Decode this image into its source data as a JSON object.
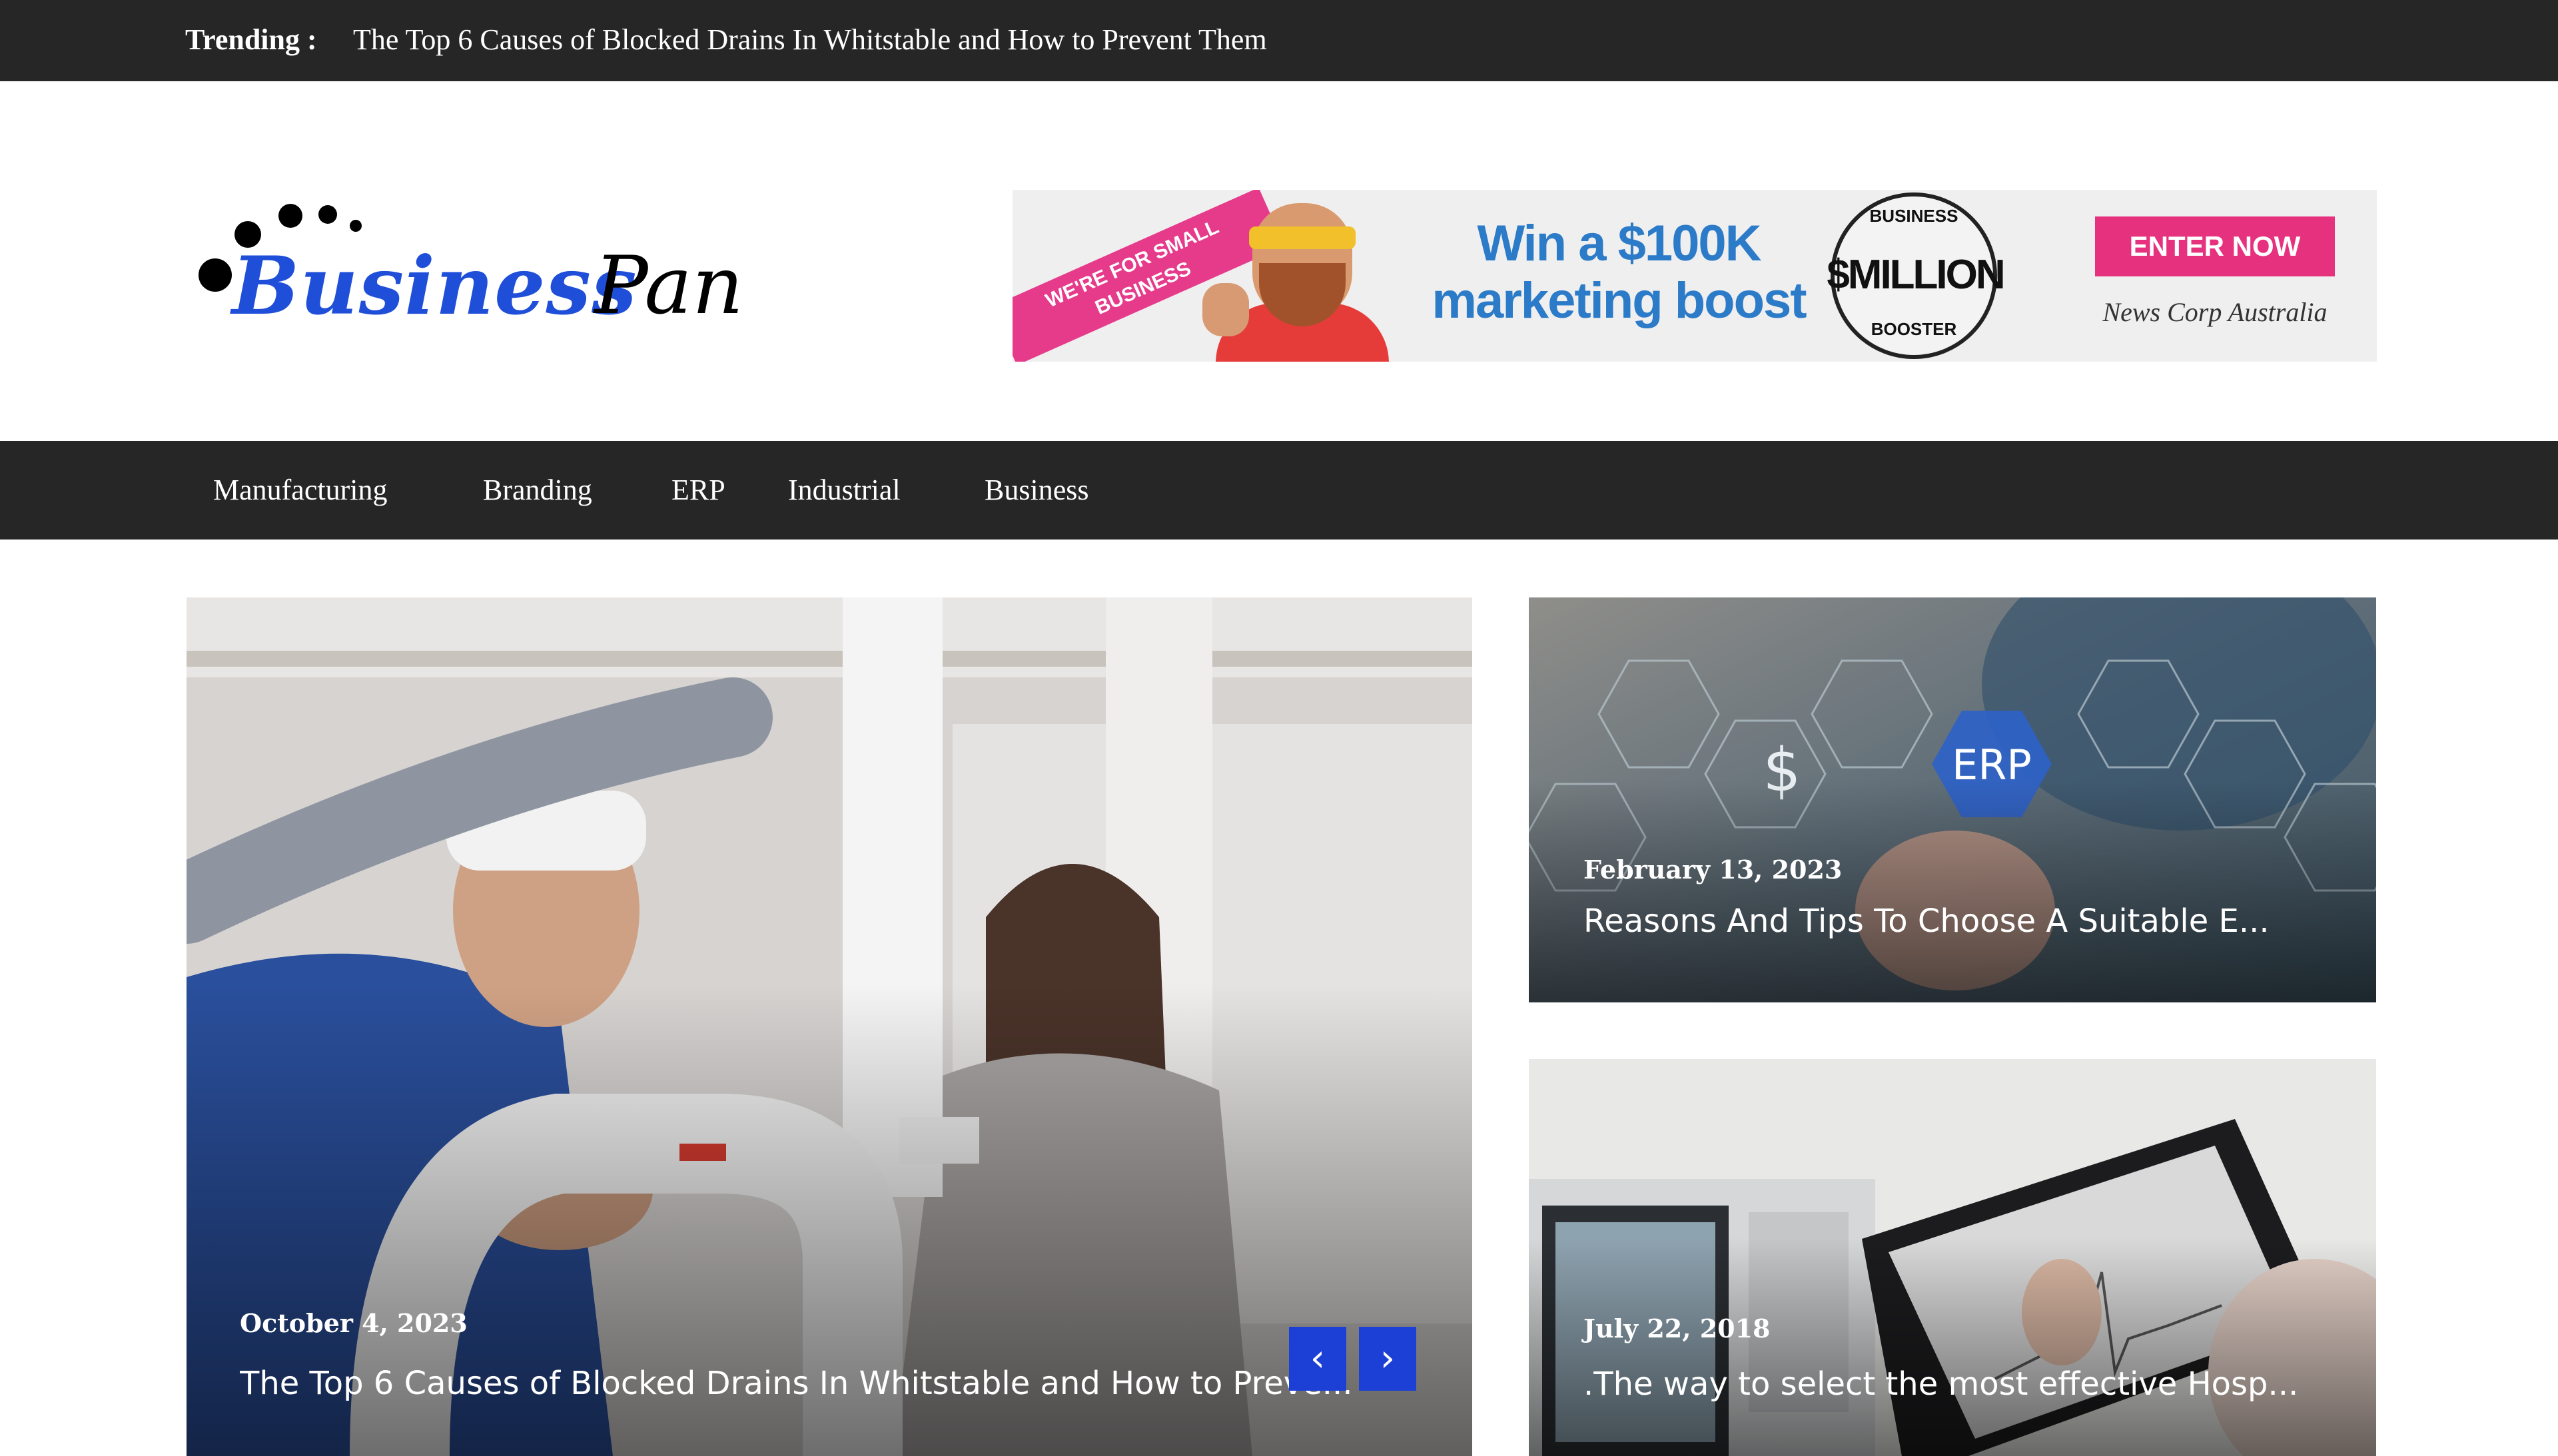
{
  "topbar": {
    "trending_label": "Trending :",
    "trending_title": "The Top 6 Causes of Blocked Drains In Whitstable and How to Prevent Them"
  },
  "logo": {
    "word1": "Business",
    "word2": "Pan"
  },
  "ad": {
    "ribbon": "WE'RE FOR SMALL BUSINESS",
    "headline_line1": "Win a $100K",
    "headline_line2": "marketing boost",
    "seal_top": "BUSINESS",
    "seal_middle": "$MILLION",
    "seal_bottom": "BOOSTER",
    "cta": "ENTER NOW",
    "brand": "News Corp Australia"
  },
  "nav": {
    "items": [
      "Manufacturing",
      "Branding",
      "ERP",
      "Industrial",
      "Business"
    ]
  },
  "featured": {
    "main": {
      "date": "October 4, 2023",
      "title": "The Top 6 Causes of Blocked Drains In Whitstable and How to Preve..."
    },
    "top_right": {
      "date": "February 13, 2023",
      "title": "Reasons And Tips To Choose A Suitable E...",
      "overlay_text": "ERP"
    },
    "bottom_right": {
      "date": "July 22, 2018",
      "title": ".The way to select the most effective Hosp..."
    }
  },
  "slider": {
    "prev_icon": "chevron-left-icon",
    "next_icon": "chevron-right-icon",
    "prev_glyph": "‹",
    "next_glyph": "›"
  },
  "colors": {
    "dark_bar": "#262626",
    "logo_blue": "#1f4fd8",
    "slider_button": "#1c3fd6",
    "ad_pink": "#e6317f"
  }
}
